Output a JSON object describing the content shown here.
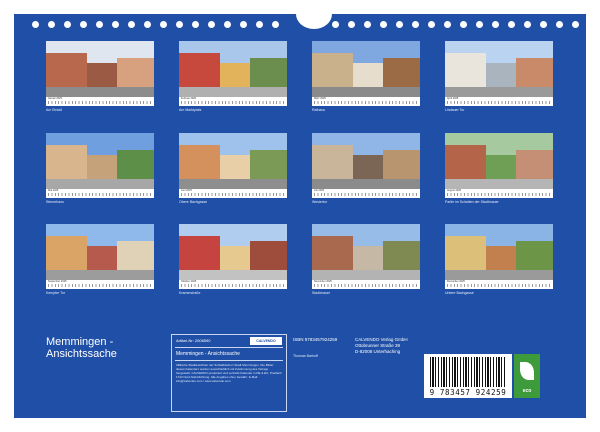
{
  "months": [
    {
      "month": "Januar 2025",
      "caption": "Am Einlaß",
      "palette": {
        "sky": "#dfe6ef",
        "b1": "#b7684d",
        "b2": "#9a5a44",
        "b3": "#d7a07e",
        "ground": "#8c8c8c"
      }
    },
    {
      "month": "Februar 2025",
      "caption": "Am Marktplatz",
      "palette": {
        "sky": "#a9c7eb",
        "b1": "#c7493d",
        "b2": "#e2b35a",
        "b3": "#6b8e4e",
        "ground": "#b0b0b0"
      }
    },
    {
      "month": "März 2025",
      "caption": "Rathaus",
      "palette": {
        "sky": "#7ea8df",
        "b1": "#c9b28b",
        "b2": "#e6ddcc",
        "b3": "#9a6b44",
        "ground": "#8a8a8a"
      }
    },
    {
      "month": "April 2025",
      "caption": "Lindauer Tor",
      "palette": {
        "sky": "#b9d3f1",
        "b1": "#e9e5dc",
        "b2": "#a9b4be",
        "b3": "#c98a6a",
        "ground": "#9a9a9a"
      }
    },
    {
      "month": "Mai 2025",
      "caption": "Steuerhaus",
      "palette": {
        "sky": "#6f9fde",
        "b1": "#d8b58c",
        "b2": "#c5a27a",
        "b3": "#5e8f48",
        "ground": "#a7a7a7"
      }
    },
    {
      "month": "Juni 2025",
      "caption": "Obere Bachgasse",
      "palette": {
        "sky": "#9ec2ec",
        "b1": "#d4915e",
        "b2": "#e8cfa8",
        "b3": "#7a9a55",
        "ground": "#8e8e8e"
      }
    },
    {
      "month": "Juli 2025",
      "caption": "Westertor",
      "palette": {
        "sky": "#8fb6e6",
        "b1": "#c9b59a",
        "b2": "#7b6656",
        "b3": "#b8956f",
        "ground": "#8b8b8b"
      }
    },
    {
      "month": "August 2025",
      "caption": "Partie im Schatten der Stadtmauer",
      "palette": {
        "sky": "#a7c9a0",
        "b1": "#b46448",
        "b2": "#6f9f54",
        "b3": "#c48f74",
        "ground": "#b5b5b5"
      }
    },
    {
      "month": "September 2025",
      "caption": "Kempter Tor",
      "palette": {
        "sky": "#8fb9ea",
        "b1": "#d9a466",
        "b2": "#b55a4c",
        "b3": "#e0d2b6",
        "ground": "#9c9c9c"
      }
    },
    {
      "month": "Oktober 2025",
      "caption": "Kramerstraße",
      "palette": {
        "sky": "#b0cdef",
        "b1": "#c6443f",
        "b2": "#e6c98e",
        "b3": "#9e4c3b",
        "ground": "#c2c2c2"
      }
    },
    {
      "month": "November 2025",
      "caption": "Stadtmauer",
      "palette": {
        "sky": "#98bce8",
        "b1": "#a9694e",
        "b2": "#c5b9a5",
        "b3": "#7f8a52",
        "ground": "#b3b3b3"
      }
    },
    {
      "month": "Dezember 2025",
      "caption": "Untere Bachgasse",
      "palette": {
        "sky": "#8ab4e6",
        "b1": "#dcc07a",
        "b2": "#c2804f",
        "b3": "#6c9548",
        "ground": "#9a9a9a"
      }
    }
  ],
  "cover": {
    "title": "Memmingen - Ansichtssache"
  },
  "product_card": {
    "article": "Artikel-Nr: 2006590",
    "logo": "CALVENDO",
    "title": "Memmingen - Ansichtssache",
    "description": "Idillische Stadtansichten der Schwäbischen Stadt Memmingen. Die Bilder dieses Kalenders wurden ausschließlich mit Zustimmung des Verlags hergestellt. CALVENDO produziert und vertreibt Kalender in DE & EU, Postfach 1722 Nord-Süd-Richtung. Alle Angaben ohne Gewähr. E-Mail: info@calvendo.com / www.calvendo.com"
  },
  "info": {
    "isbn": "ISBN 9783457924259",
    "author": "Thomas Barhoff",
    "publisher": [
      "CALVENDO Verlag GmbH",
      "Ottobrunner Straße 39",
      "D-82008 Unterhaching"
    ]
  },
  "barcode": {
    "number": "9 783457 924259"
  },
  "eco": {
    "label": "eco",
    "color": "#3e9b3c"
  },
  "colors": {
    "background": "#1f4fa6"
  }
}
